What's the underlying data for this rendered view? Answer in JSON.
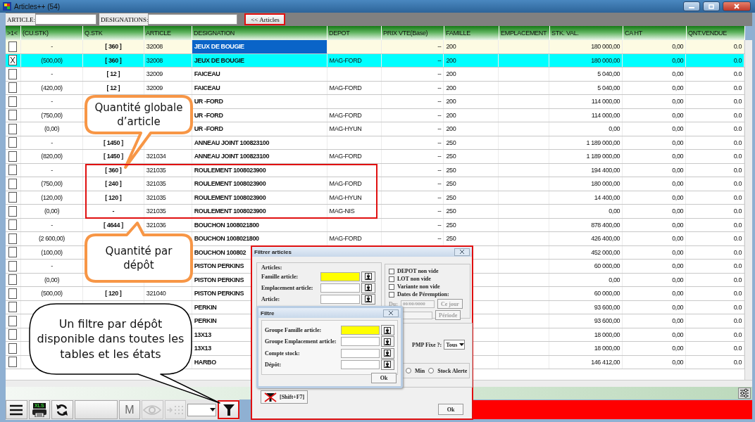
{
  "window": {
    "title": "Articles++ (54)"
  },
  "search": {
    "fields": [
      {
        "label": "ARTICLE:"
      },
      {
        "label": "DESIGNATIONS:"
      }
    ],
    "button": {
      "label": "<< Articles",
      "outlined": true
    }
  },
  "table": {
    "checkbox_column": ">1<",
    "columns": [
      "(CU.STK)",
      "Q.STK",
      "ARTICLE",
      "DESIGNATION",
      "DEPOT",
      "PRIX VTE(Base)",
      "FAMILLE",
      "EMPLACEMENT",
      "STK. VAL.",
      "CA HT",
      "QNT.VENDUE"
    ],
    "rows": [
      {
        "checked": false,
        "selected": false,
        "focused": true,
        "framed": false,
        "cells": [
          "-",
          "[ 360 ]",
          "32008",
          "JEUX DE BOUGIE",
          null,
          "--",
          "200",
          null,
          "180 000,00",
          "0,00",
          "0.0"
        ]
      },
      {
        "checked": true,
        "selected": true,
        "focused": false,
        "framed": false,
        "cells": [
          "(500,00)",
          "[ 360 ]",
          "32008",
          "JEUX DE BOUGIE",
          "MAG-FORD",
          "--",
          "200",
          null,
          "180 000,00",
          "0,00",
          "0.0"
        ]
      },
      {
        "checked": false,
        "selected": false,
        "focused": false,
        "framed": false,
        "cells": [
          "-",
          "[ 12 ]",
          "32009",
          "FAICEAU",
          null,
          "--",
          "200",
          null,
          "5 040,00",
          "0,00",
          "0.0"
        ]
      },
      {
        "checked": false,
        "selected": false,
        "focused": false,
        "framed": false,
        "cells": [
          "(420,00)",
          "[ 12 ]",
          "32009",
          "FAICEAU",
          "MAG-FORD",
          "--",
          "200",
          null,
          "5 040,00",
          "0,00",
          "0.0"
        ]
      },
      {
        "checked": false,
        "selected": false,
        "focused": false,
        "framed": false,
        "cells": [
          "-",
          null,
          null,
          "UR -FORD",
          null,
          "--",
          "200",
          null,
          "114 000,00",
          "0,00",
          "0.0"
        ]
      },
      {
        "checked": false,
        "selected": false,
        "focused": false,
        "framed": false,
        "cells": [
          "(750,00)",
          null,
          null,
          "UR -FORD",
          "MAG-FORD",
          "--",
          "200",
          null,
          "114 000,00",
          "0,00",
          "0.0"
        ]
      },
      {
        "checked": false,
        "selected": false,
        "focused": false,
        "framed": false,
        "cells": [
          "(0,00)",
          null,
          null,
          "UR -FORD",
          "MAG-HYUN",
          "--",
          "200",
          null,
          "0,00",
          "0,00",
          "0.0"
        ]
      },
      {
        "checked": false,
        "selected": false,
        "focused": false,
        "framed": false,
        "cells": [
          "-",
          "[ 1450 ]",
          null,
          "ANNEAU JOINT 100823100",
          null,
          "--",
          "250",
          null,
          "1 189 000,00",
          "0,00",
          "0.0"
        ]
      },
      {
        "checked": false,
        "selected": false,
        "focused": false,
        "framed": false,
        "cells": [
          "(820,00)",
          "[ 1450 ]",
          "321034",
          "ANNEAU JOINT 100823100",
          "MAG-FORD",
          "--",
          "250",
          null,
          "1 189 000,00",
          "0,00",
          "0.0"
        ]
      },
      {
        "checked": false,
        "selected": false,
        "focused": false,
        "framed": true,
        "cells": [
          "-",
          "[ 360 ]",
          "321035",
          "ROULEMENT 1008023900",
          null,
          "--",
          "250",
          null,
          "194 400,00",
          "0,00",
          "0.0"
        ]
      },
      {
        "checked": false,
        "selected": false,
        "focused": false,
        "framed": true,
        "cells": [
          "(750,00)",
          "[ 240 ]",
          "321035",
          "ROULEMENT 1008023900",
          "MAG-FORD",
          "--",
          "250",
          null,
          "180 000,00",
          "0,00",
          "0.0"
        ]
      },
      {
        "checked": false,
        "selected": false,
        "focused": false,
        "framed": true,
        "cells": [
          "(120,00)",
          "[ 120 ]",
          "321035",
          "ROULEMENT 1008023900",
          "MAG-HYUN",
          "--",
          "250",
          null,
          "14 400,00",
          "0,00",
          "0.0"
        ]
      },
      {
        "checked": false,
        "selected": false,
        "focused": false,
        "framed": true,
        "cells": [
          "(0,00)",
          "-",
          "321035",
          "ROULEMENT 1008023900",
          "MAG-NIS",
          "--",
          "250",
          null,
          "0,00",
          "0,00",
          "0.0"
        ]
      },
      {
        "checked": false,
        "selected": false,
        "focused": false,
        "framed": false,
        "cells": [
          "-",
          "[ 4644 ]",
          "321036",
          "BOUCHON 1008021800",
          null,
          "--",
          "250",
          null,
          "878 400,00",
          "0,00",
          "0.0"
        ]
      },
      {
        "checked": false,
        "selected": false,
        "focused": false,
        "framed": false,
        "cells": [
          "(2 600,00)",
          null,
          null,
          "BOUCHON 1008021800",
          "MAG-FORD",
          "--",
          "250",
          null,
          "426 400,00",
          "0,00",
          "0.0"
        ]
      },
      {
        "checked": false,
        "selected": false,
        "focused": false,
        "framed": false,
        "cells": [
          "(100,00)",
          null,
          null,
          "BOUCHON 100802",
          null,
          null,
          null,
          null,
          "452 000,00",
          "0,00",
          "0.0"
        ]
      },
      {
        "checked": false,
        "selected": false,
        "focused": false,
        "framed": false,
        "cells": [
          "-",
          null,
          null,
          "PISTON PERKINS",
          null,
          null,
          null,
          null,
          "60 000,00",
          "0,00",
          "0.0"
        ]
      },
      {
        "checked": false,
        "selected": false,
        "focused": false,
        "framed": false,
        "cells": [
          "(0,00)",
          null,
          null,
          "PISTON PERKINS",
          null,
          null,
          null,
          null,
          "0,00",
          "0,00",
          "0.0"
        ]
      },
      {
        "checked": false,
        "selected": false,
        "focused": false,
        "framed": false,
        "cells": [
          "(500,00)",
          "[ 120 ]",
          "321040",
          "PISTON PERKINS",
          null,
          null,
          null,
          null,
          "60 000,00",
          "0,00",
          "0.0"
        ]
      },
      {
        "checked": false,
        "selected": false,
        "focused": false,
        "framed": false,
        "cells": [
          null,
          null,
          null,
          "PERKIN",
          null,
          null,
          null,
          null,
          "93 600,00",
          "0,00",
          "0.0"
        ]
      },
      {
        "checked": false,
        "selected": false,
        "focused": false,
        "framed": false,
        "cells": [
          null,
          null,
          null,
          "PERKIN",
          null,
          null,
          null,
          null,
          "93 600,00",
          "0,00",
          "0.0"
        ]
      },
      {
        "checked": false,
        "selected": false,
        "focused": false,
        "framed": false,
        "cells": [
          null,
          null,
          null,
          "13X13",
          null,
          null,
          null,
          null,
          "18 000,00",
          "0,00",
          "0.0"
        ]
      },
      {
        "checked": false,
        "selected": false,
        "focused": false,
        "framed": false,
        "cells": [
          null,
          null,
          null,
          "13X13",
          null,
          null,
          null,
          null,
          "18 000,00",
          "0,00",
          "0.0"
        ]
      },
      {
        "checked": false,
        "selected": false,
        "focused": false,
        "framed": false,
        "cells": [
          null,
          null,
          null,
          "HARBO",
          null,
          null,
          null,
          null,
          "146 412,00",
          "0,00",
          "0.0"
        ]
      }
    ]
  },
  "toolbar": [
    {
      "kind": "menu",
      "disabled": false,
      "outlined": false
    },
    {
      "kind": "export",
      "label": "XLS",
      "disabled": false,
      "outlined": false
    },
    {
      "kind": "refresh",
      "disabled": false,
      "outlined": false
    },
    {
      "kind": "blank",
      "disabled": false,
      "outlined": false
    },
    {
      "kind": "text",
      "label": "M",
      "disabled": true,
      "outlined": false
    },
    {
      "kind": "eye",
      "disabled": true,
      "outlined": false
    },
    {
      "kind": "move",
      "disabled": true,
      "outlined": false
    },
    {
      "kind": "dropdown",
      "disabled": false,
      "outlined": false
    },
    {
      "kind": "filter",
      "disabled": false,
      "outlined": true
    }
  ],
  "callouts": [
    {
      "kind": "orange",
      "text": "Quantité globale d’article"
    },
    {
      "kind": "orange",
      "text": "Quantité par dépôt"
    },
    {
      "kind": "dark",
      "text": "Un filtre par dépôt disponible dans toutes les tables et les états"
    }
  ],
  "filter_dialog": {
    "title": "Filtrer articles",
    "outlined": true,
    "group_title": "Articles:",
    "fields": [
      {
        "label": "Famille article:",
        "highlighted": true
      },
      {
        "label": "Emplacement article:",
        "highlighted": false
      },
      {
        "label": "Article:",
        "highlighted": false
      }
    ],
    "checkboxes": [
      {
        "label": "DEPOT non vide",
        "checked": false
      },
      {
        "label": "LOT non vide",
        "checked": false
      },
      {
        "label": "Variante non vide",
        "checked": false
      },
      {
        "label": "Dates de Péremption:",
        "checked": false
      }
    ],
    "date_from": {
      "label": "Du:",
      "value": "00/00/0000",
      "disabled": true
    },
    "today_button": {
      "label": "Ce jour",
      "disabled": true
    },
    "period_button": {
      "label": "Période",
      "disabled": true
    },
    "pmp": {
      "label": "PMP Fixe ?:",
      "value": "Tous"
    },
    "radios": [
      {
        "label": "Min",
        "selected": false
      },
      {
        "label": "Stock Alerte",
        "selected": false
      }
    ],
    "clear_button": {
      "label": "[Shift+F7]"
    },
    "ok_button": {
      "label": "Ok"
    }
  },
  "sub_dialog": {
    "title": "Filtre",
    "fields": [
      {
        "label": "Groupe Famille article:",
        "highlighted": true
      },
      {
        "label": "Groupe Emplacement article:",
        "highlighted": false
      },
      {
        "label": "Compte stock:",
        "highlighted": false
      },
      {
        "label": "Dépôt:",
        "highlighted": false
      }
    ],
    "ok_button": {
      "label": "Ok"
    }
  }
}
